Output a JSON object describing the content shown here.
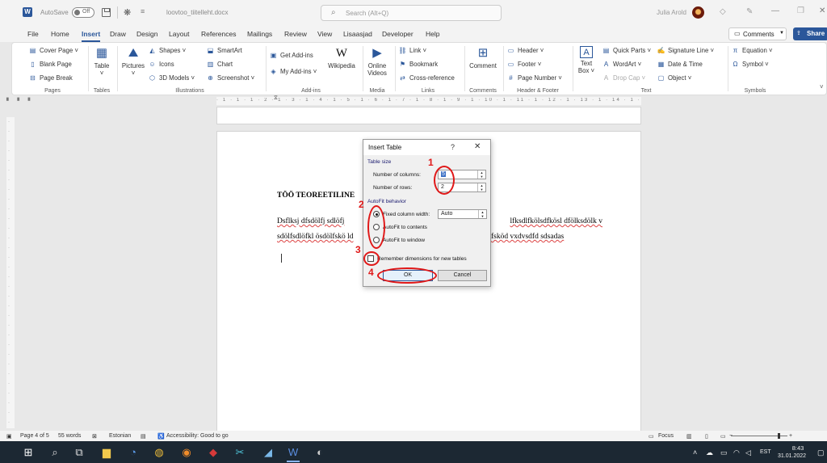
{
  "titlebar": {
    "autosave_label": "AutoSave",
    "autosave_state": "Off",
    "doc_title": "loovtoo_tiitelleht.docx",
    "search_placeholder": "Search (Alt+Q)",
    "user_name": "Julia Arold"
  },
  "menu": {
    "tabs": [
      "File",
      "Home",
      "Insert",
      "Draw",
      "Design",
      "Layout",
      "References",
      "Mailings",
      "Review",
      "View",
      "Lisaasjad",
      "Developer",
      "Help"
    ],
    "active_tab": "Insert",
    "comments_label": "Comments",
    "share_label": "Share"
  },
  "ribbon": {
    "pages": {
      "cover_page": "Cover Page",
      "blank_page": "Blank Page",
      "page_break": "Page Break",
      "group": "Pages"
    },
    "tables": {
      "table": "Table",
      "group": "Tables"
    },
    "illustrations": {
      "pictures": "Pictures",
      "shapes": "Shapes",
      "icons": "Icons",
      "models_3d": "3D Models",
      "smartart": "SmartArt",
      "chart": "Chart",
      "screenshot": "Screenshot",
      "group": "Illustrations"
    },
    "addins": {
      "get_addins": "Get Add-ins",
      "my_addins": "My Add-ins",
      "wikipedia": "Wikipedia",
      "group": "Add-ins"
    },
    "media": {
      "online_videos_1": "Online",
      "online_videos_2": "Videos",
      "group": "Media"
    },
    "links": {
      "link": "Link",
      "bookmark": "Bookmark",
      "cross_reference": "Cross-reference",
      "group": "Links"
    },
    "comments": {
      "comment": "Comment",
      "group": "Comments"
    },
    "header_footer": {
      "header": "Header",
      "footer": "Footer",
      "page_number": "Page Number",
      "group": "Header & Footer"
    },
    "text": {
      "text_box_1": "Text",
      "text_box_2": "Box",
      "quick_parts": "Quick Parts",
      "wordart": "WordArt",
      "drop_cap": "Drop Cap",
      "signature_line": "Signature Line",
      "date_time": "Date & Time",
      "object": "Object",
      "group": "Text"
    },
    "symbols": {
      "equation": "Equation",
      "symbol": "Symbol",
      "group": "Symbols"
    }
  },
  "document": {
    "heading": "TÖÖ TEOREETILINE",
    "line1_left": "Dsflksj  dfsdölfj  sdlöfj",
    "line1_right": "lfksdlfkölsdfkösl  dfölksdölk  v",
    "line2_left": "sdölfsdlöfkl ösdölfskö ld",
    "line2_right": "fsköd vxdvsdfd sdsadas"
  },
  "dialog": {
    "title": "Insert Table",
    "help": "?",
    "close": "✕",
    "table_size_label": "Table size",
    "columns_label": "Number of columns:",
    "columns_value": "5",
    "rows_label": "Number of rows:",
    "rows_value": "2",
    "autofit_label": "AutoFit behavior",
    "fixed_width_label": "Fixed column width:",
    "fixed_width_value": "Auto",
    "autofit_contents_label": "AutoFit to contents",
    "autofit_window_label": "AutoFit to window",
    "remember_label": "Remember dimensions for new tables",
    "ok_label": "OK",
    "cancel_label": "Cancel"
  },
  "annotations": [
    "1",
    "2",
    "3",
    "4"
  ],
  "annotation_color": "#e01818",
  "statusbar": {
    "page": "Page 4 of 5",
    "words": "55 words",
    "language": "Estonian",
    "accessibility": "Accessibility: Good to go",
    "focus": "Focus"
  },
  "taskbar": {
    "language": "EST",
    "time": "8:43",
    "date": "31.01.2022"
  },
  "colors": {
    "accent": "#2b579a",
    "taskbar": "#1c2833"
  }
}
